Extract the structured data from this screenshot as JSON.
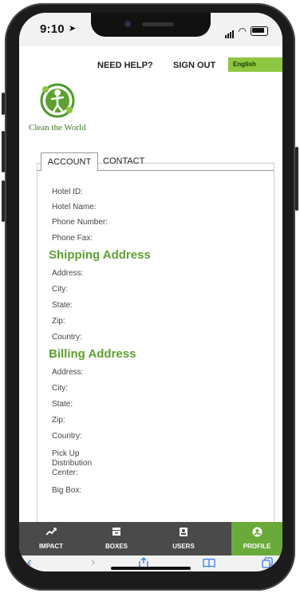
{
  "status": {
    "time": "9:10"
  },
  "header": {
    "need_help": "NEED HELP?",
    "sign_out": "SIGN OUT",
    "language": "English"
  },
  "brand": {
    "name": "Clean the World"
  },
  "tabs": {
    "account": "ACCOUNT",
    "contact": "CONTACT"
  },
  "account_fields": {
    "hotel_id": "Hotel ID:",
    "hotel_name": "Hotel Name:",
    "phone_number": "Phone Number:",
    "phone_fax": "Phone Fax:"
  },
  "shipping": {
    "title": "Shipping Address",
    "address": "Address:",
    "city": "City:",
    "state": "State:",
    "zip": "Zip:",
    "country": "Country:"
  },
  "billing": {
    "title": "Billing Address",
    "address": "Address:",
    "city": "City:",
    "state": "State:",
    "zip": "Zip:",
    "country": "Country:",
    "pickup_l1": "Pick Up",
    "pickup_l2": "Distribution",
    "pickup_l3": "Center:",
    "big_box": "Big Box:"
  },
  "bottom_nav": {
    "impact": "IMPACT",
    "boxes": "BOXES",
    "users": "USERS",
    "profile": "PROFILE"
  },
  "colors": {
    "accent_green": "#5da130",
    "language_green": "#8dc63f",
    "active_nav_green": "#6aaa3a",
    "nav_dark": "#4a4a4a",
    "safari_blue": "#2f7cf6"
  },
  "icons": {
    "impact": "trend-up-icon",
    "boxes": "box-icon",
    "users": "id-card-icon",
    "profile": "profile-icon"
  }
}
